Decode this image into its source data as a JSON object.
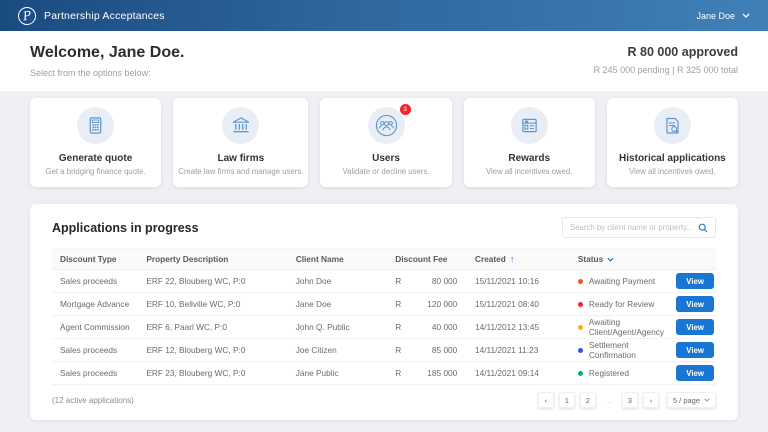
{
  "header": {
    "title": "Partnership Acceptances",
    "user": "Jane Doe",
    "logo_letter": "P"
  },
  "welcome": {
    "title": "Welcome, Jane Doe.",
    "subtitle": "Select from the options below:",
    "approved": "R 80 000 approved",
    "pending_total": "R 245 000 pending  |  R 325 000 total"
  },
  "cards": [
    {
      "icon": "calculator-icon",
      "title": "Generate quote",
      "subtitle": "Get a bridging finance quote.",
      "badge": ""
    },
    {
      "icon": "bank-icon",
      "title": "Law firms",
      "subtitle": "Create law firms and manage users.",
      "badge": ""
    },
    {
      "icon": "users-icon",
      "title": "Users",
      "subtitle": "Validate or decline users.",
      "badge": "3"
    },
    {
      "icon": "rewards-icon",
      "title": "Rewards",
      "subtitle": "View all incentives owed.",
      "badge": ""
    },
    {
      "icon": "history-icon",
      "title": "Historical applications",
      "subtitle": "View all incentives owed.",
      "badge": ""
    }
  ],
  "table": {
    "title": "Applications in progress",
    "search_placeholder": "Search by client name or property...",
    "columns": {
      "discount_type": "Discount Type",
      "property_description": "Property Description",
      "client_name": "Client Name",
      "discount_fee": "Discount Fee",
      "created": "Created",
      "status": "Status"
    },
    "sort_icon": "↑",
    "view_label": "View",
    "rows": [
      {
        "discount_type": "Sales proceeds",
        "property": "ERF 22, Blouberg WC, P:0",
        "client": "John Doe",
        "fee_currency": "R",
        "fee_amount": "80 000",
        "created": "15/11/2021 10:16",
        "status": "Awaiting Payment",
        "status_color": "#fa541c"
      },
      {
        "discount_type": "Mortgage Advance",
        "property": "ERF 10, Bellville WC, P:0",
        "client": "Jane Doe",
        "fee_currency": "R",
        "fee_amount": "120 000",
        "created": "15/11/2021 08:40",
        "status": "Ready for Review",
        "status_color": "#f5222d"
      },
      {
        "discount_type": "Agent Commission",
        "property": "ERF 6, Paarl WC, P:0",
        "client": "John Q. Public",
        "fee_currency": "R",
        "fee_amount": "40 000",
        "created": "14/11/2012 13:45",
        "status": "Awaiting Client/Agent/Agency",
        "status_color": "#faad14"
      },
      {
        "discount_type": "Sales proceeds",
        "property": "ERF 12, Blouberg WC, P:0",
        "client": "Joe Citizen",
        "fee_currency": "R",
        "fee_amount": "85 000",
        "created": "14/11/2021 11:23",
        "status": "Settlement Confirmation",
        "status_color": "#2f54eb"
      },
      {
        "discount_type": "Sales proceeds",
        "property": "ERF 23, Blouberg WC, P:0",
        "client": "Jane Public",
        "fee_currency": "R",
        "fee_amount": "185 000",
        "created": "14/11/2021 09:14",
        "status": "Registered",
        "status_color": "#00b578"
      }
    ],
    "footer_note": "(12 active applications)",
    "pagination": {
      "prev": "‹",
      "next": "›",
      "pages": [
        "1",
        "2",
        "…",
        "3"
      ],
      "page_size": "5 / page"
    }
  },
  "colors": {
    "accent": "#1976d2",
    "header_gradient_start": "#1a4b80",
    "header_gradient_end": "#4080b8",
    "badge_red": "#f5222d",
    "icon_blue": "#5d97cf"
  }
}
